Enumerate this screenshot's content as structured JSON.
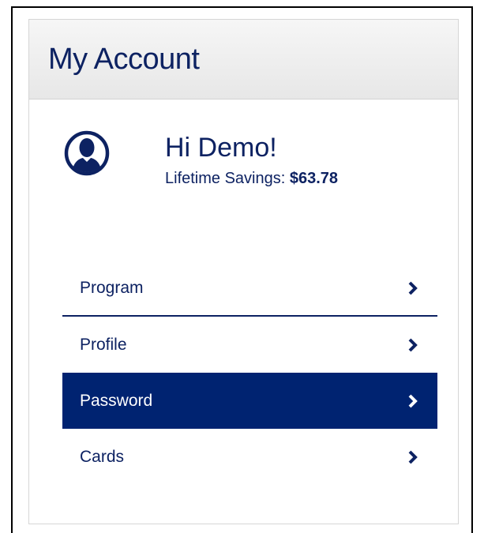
{
  "account": {
    "title": "My Account",
    "greeting": "Hi Demo!",
    "savings_label": "Lifetime Savings:",
    "savings_value": "$63.78"
  },
  "menu": {
    "items": [
      {
        "label": "Program",
        "icon": "chevron-right-icon"
      },
      {
        "label": "Profile",
        "icon": "chevron-right-icon"
      },
      {
        "label": "Password",
        "icon": "chevron-right-icon",
        "active": true
      },
      {
        "label": "Cards",
        "icon": "chevron-right-icon"
      }
    ]
  },
  "colors": {
    "brand_navy": "#0d2262",
    "active_bg": "#002371",
    "header_bg": "#ececec"
  }
}
